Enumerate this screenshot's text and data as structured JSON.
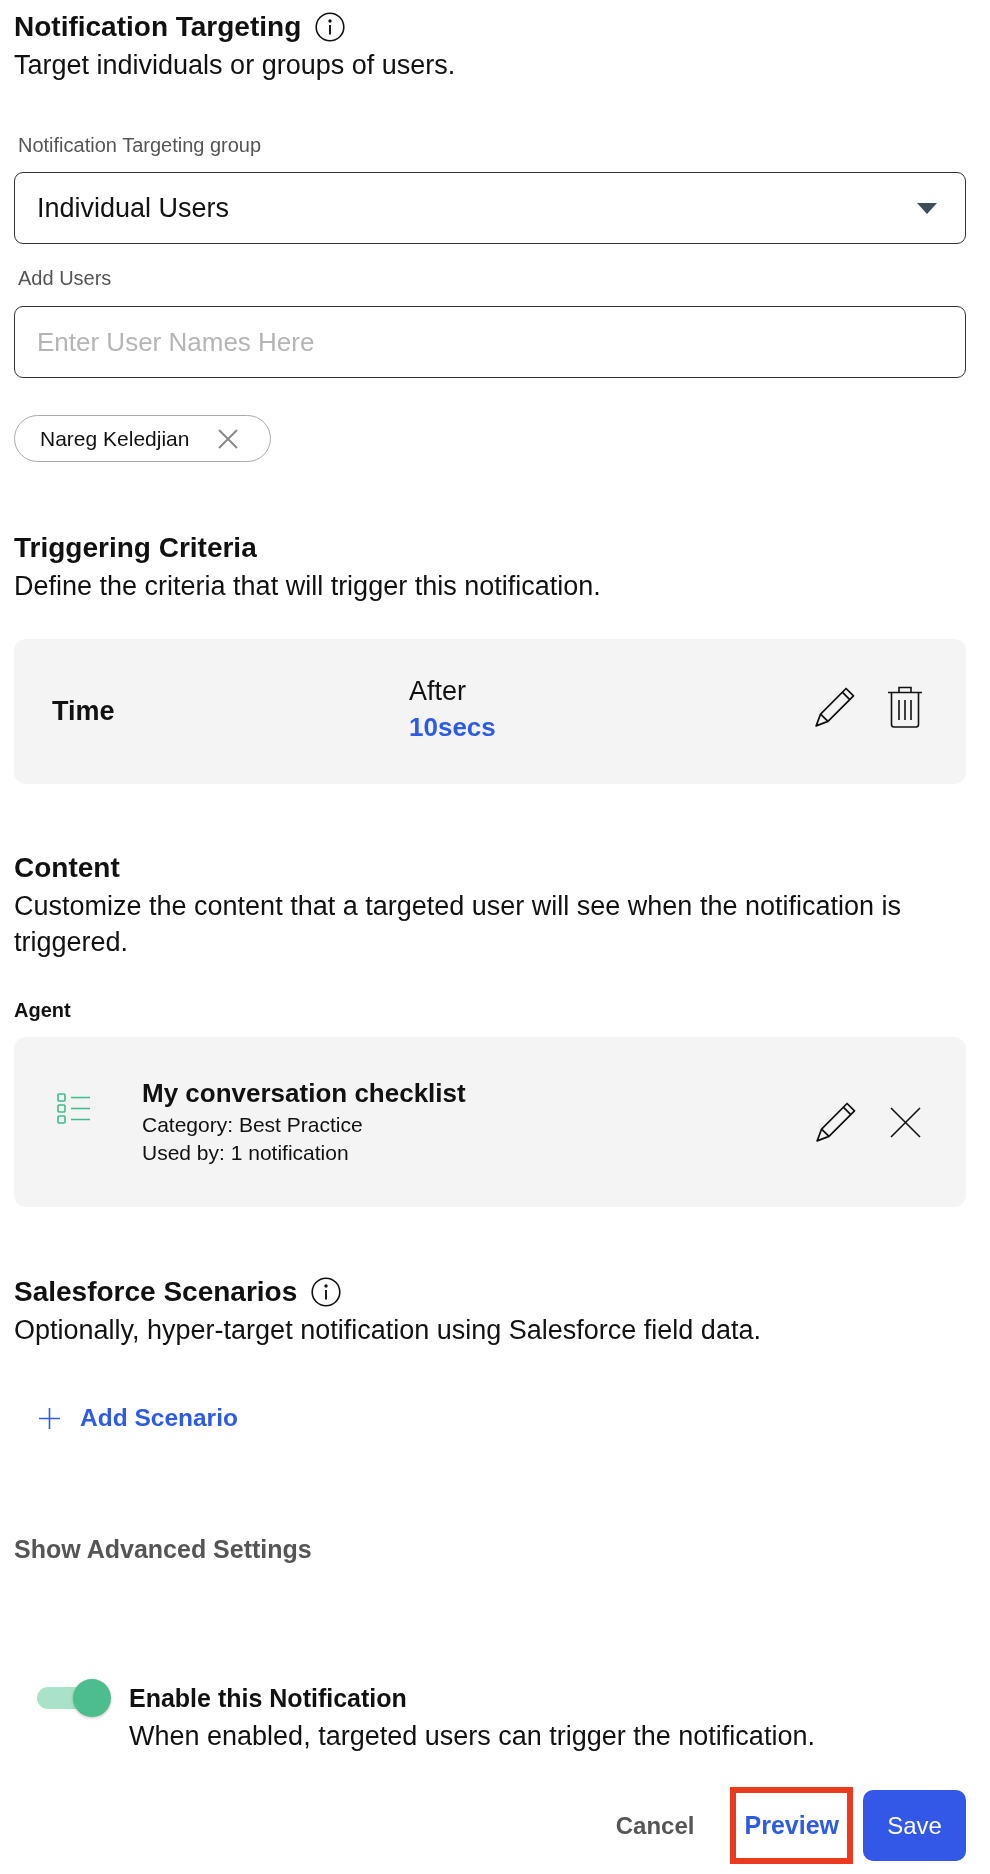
{
  "targeting": {
    "title": "Notification Targeting",
    "description": "Target individuals or groups of users.",
    "group_field": {
      "label": "Notification Targeting group",
      "value": "Individual Users"
    },
    "users_field": {
      "label": "Add Users",
      "placeholder": "Enter User Names Here"
    },
    "chips": [
      {
        "label": "Nareg Keledjian"
      }
    ]
  },
  "triggering": {
    "title": "Triggering Criteria",
    "description": "Define the criteria that will trigger this notification.",
    "criteria": [
      {
        "name": "Time",
        "condition": "After",
        "value": "10secs"
      }
    ]
  },
  "content": {
    "title": "Content",
    "description": "Customize the content that a targeted user will see when the notification is triggered.",
    "section_label": "Agent",
    "items": [
      {
        "title": "My conversation checklist",
        "category": "Category: Best Practice",
        "usage": "Used by: 1 notification"
      }
    ]
  },
  "salesforce": {
    "title": "Salesforce Scenarios",
    "description": "Optionally, hyper-target notification using Salesforce field data.",
    "add_button": "Add Scenario"
  },
  "advanced_toggle": "Show Advanced Settings",
  "enable": {
    "label": "Enable this Notification",
    "description": "When enabled, targeted users can trigger the notification.",
    "on": true
  },
  "actions": [
    {
      "kind": "text",
      "label": "Cancel",
      "highlighted": false
    },
    {
      "kind": "link",
      "label": "Preview",
      "highlighted": true
    },
    {
      "kind": "primary",
      "label": "Save",
      "highlighted": false
    }
  ]
}
